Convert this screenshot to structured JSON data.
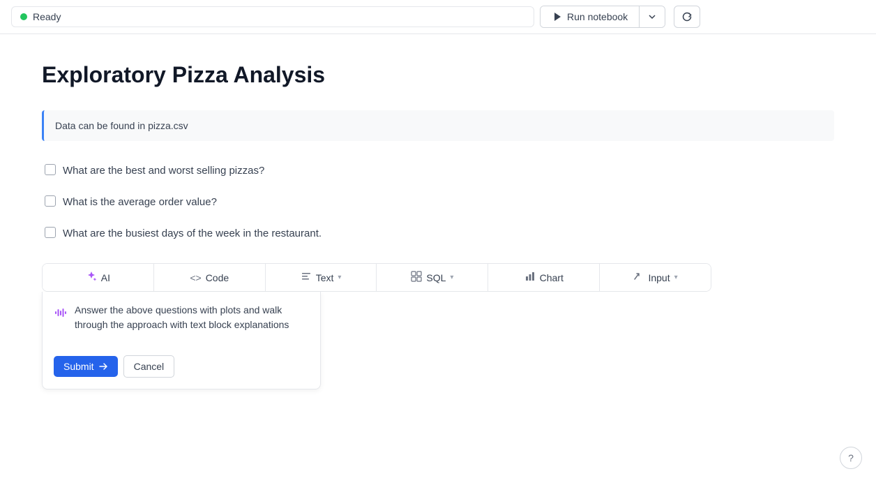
{
  "topbar": {
    "status_label": "Ready",
    "run_button_label": "Run notebook",
    "dropdown_arrow": "▾",
    "refresh_icon": "↻"
  },
  "page": {
    "title": "Exploratory Pizza Analysis"
  },
  "info_block": {
    "text": "Data can be found in pizza.csv"
  },
  "checklist": {
    "items": [
      {
        "id": "q1",
        "label": "What are the best and worst selling pizzas?"
      },
      {
        "id": "q2",
        "label": "What is the average order value?"
      },
      {
        "id": "q3",
        "label": "What are the busiest days of the week in the restaurant."
      }
    ]
  },
  "toolbar": {
    "tabs": [
      {
        "id": "ai",
        "label": "AI",
        "icon": "✦"
      },
      {
        "id": "code",
        "label": "Code",
        "icon": "<>"
      },
      {
        "id": "text",
        "label": "Text",
        "icon": "T",
        "has_dropdown": true
      },
      {
        "id": "sql",
        "label": "SQL",
        "icon": "⊞",
        "has_dropdown": true
      },
      {
        "id": "chart",
        "label": "Chart",
        "icon": "▦"
      },
      {
        "id": "input",
        "label": "Input",
        "icon": "✎",
        "has_dropdown": true
      }
    ]
  },
  "ai_panel": {
    "textarea_value": "Answer the above questions with plots and walk through the approach with text block explanations",
    "submit_label": "Submit",
    "cancel_label": "Cancel"
  },
  "help": {
    "label": "?"
  }
}
